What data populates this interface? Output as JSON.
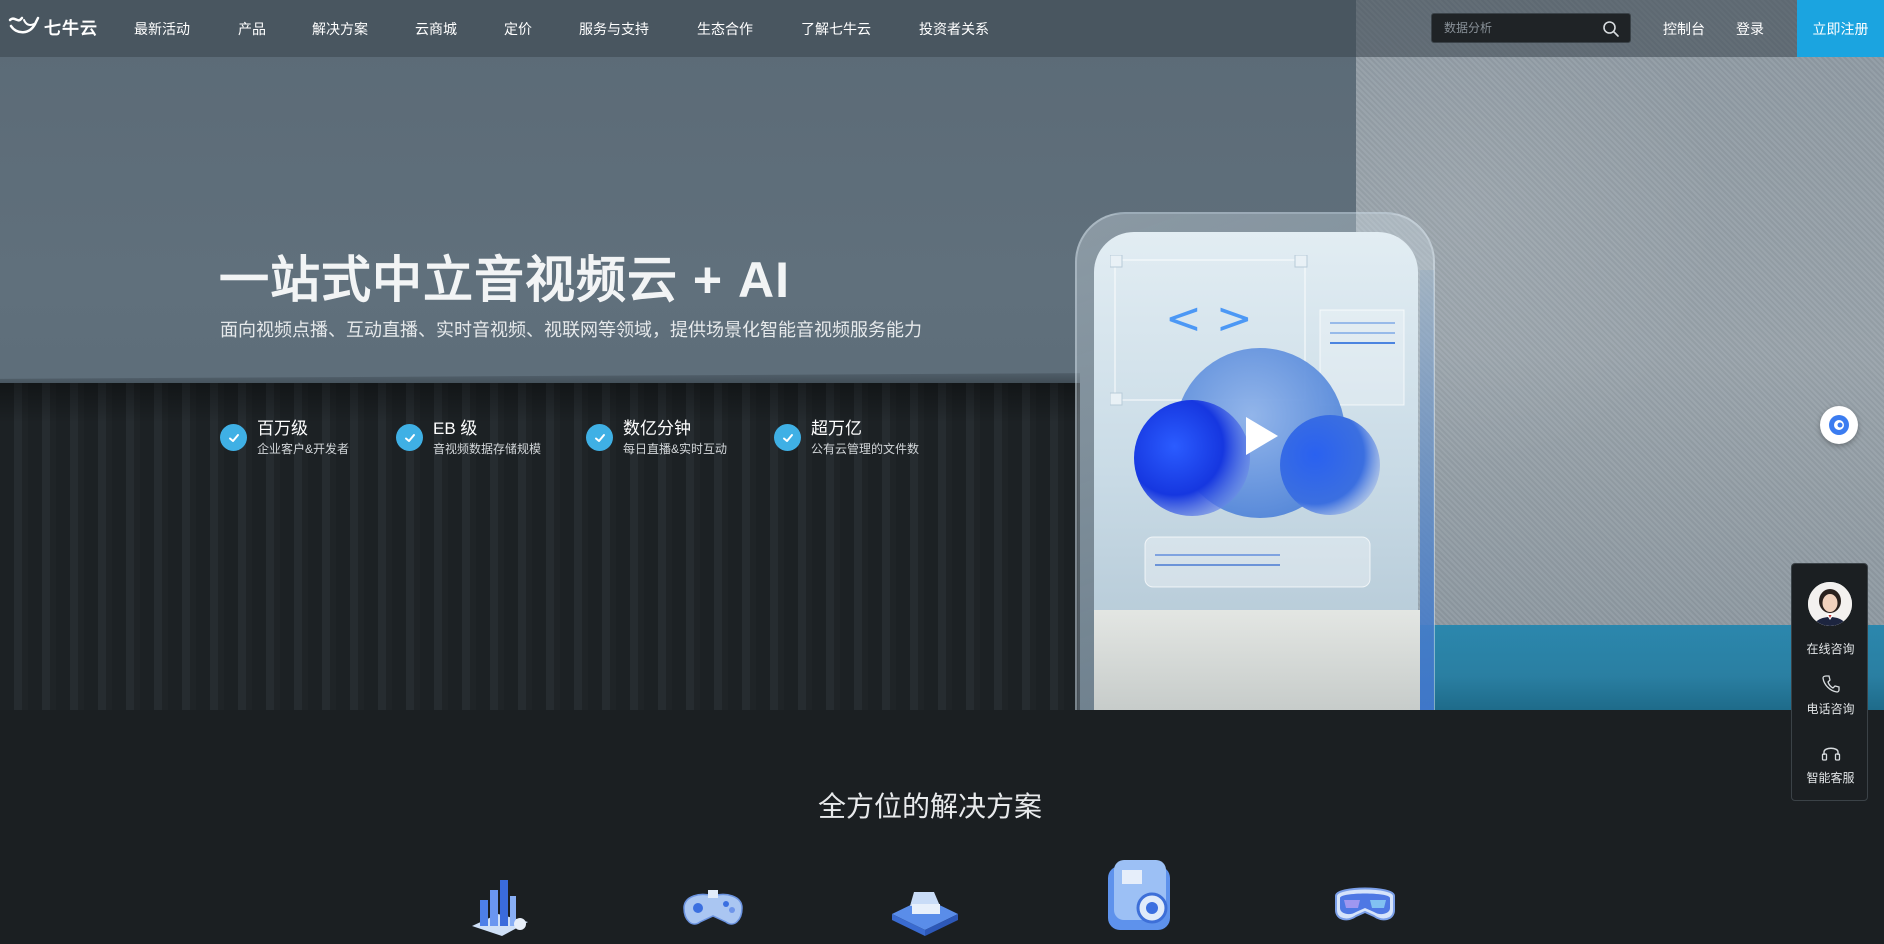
{
  "brand": {
    "name": "七牛云"
  },
  "nav": {
    "items": [
      "最新活动",
      "产品",
      "解决方案",
      "云商城",
      "定价",
      "服务与支持",
      "生态合作",
      "了解七牛云",
      "投资者关系"
    ],
    "search_placeholder": "数据分析",
    "console": "控制台",
    "login": "登录",
    "signup": "立即注册"
  },
  "hero": {
    "title": "一站式中立音视频云 + AI",
    "subtitle": "面向视频点播、互动直播、实时音视频、视联网等领域，提供场景化智能音视频服务能力",
    "stats": [
      {
        "title": "百万级",
        "desc": "企业客户&开发者"
      },
      {
        "title": "EB 级",
        "desc": "音视频数据存储规模"
      },
      {
        "title": "数亿分钟",
        "desc": "每日直播&实时互动"
      },
      {
        "title": "超万亿",
        "desc": "公有云管理的文件数"
      }
    ]
  },
  "side_panel": {
    "online": "在线咨询",
    "phone": "电话咨询",
    "bot": "智能客服"
  },
  "solutions": {
    "title": "全方位的解决方案",
    "icons": [
      "chart-3d-icon",
      "gamepad-3d-icon",
      "car-3d-icon",
      "camera-3d-icon",
      "vr-headset-3d-icon"
    ]
  },
  "colors": {
    "accent": "#1ba4e0",
    "check": "#3fb0e5",
    "dark_bg": "#1b1f22"
  }
}
